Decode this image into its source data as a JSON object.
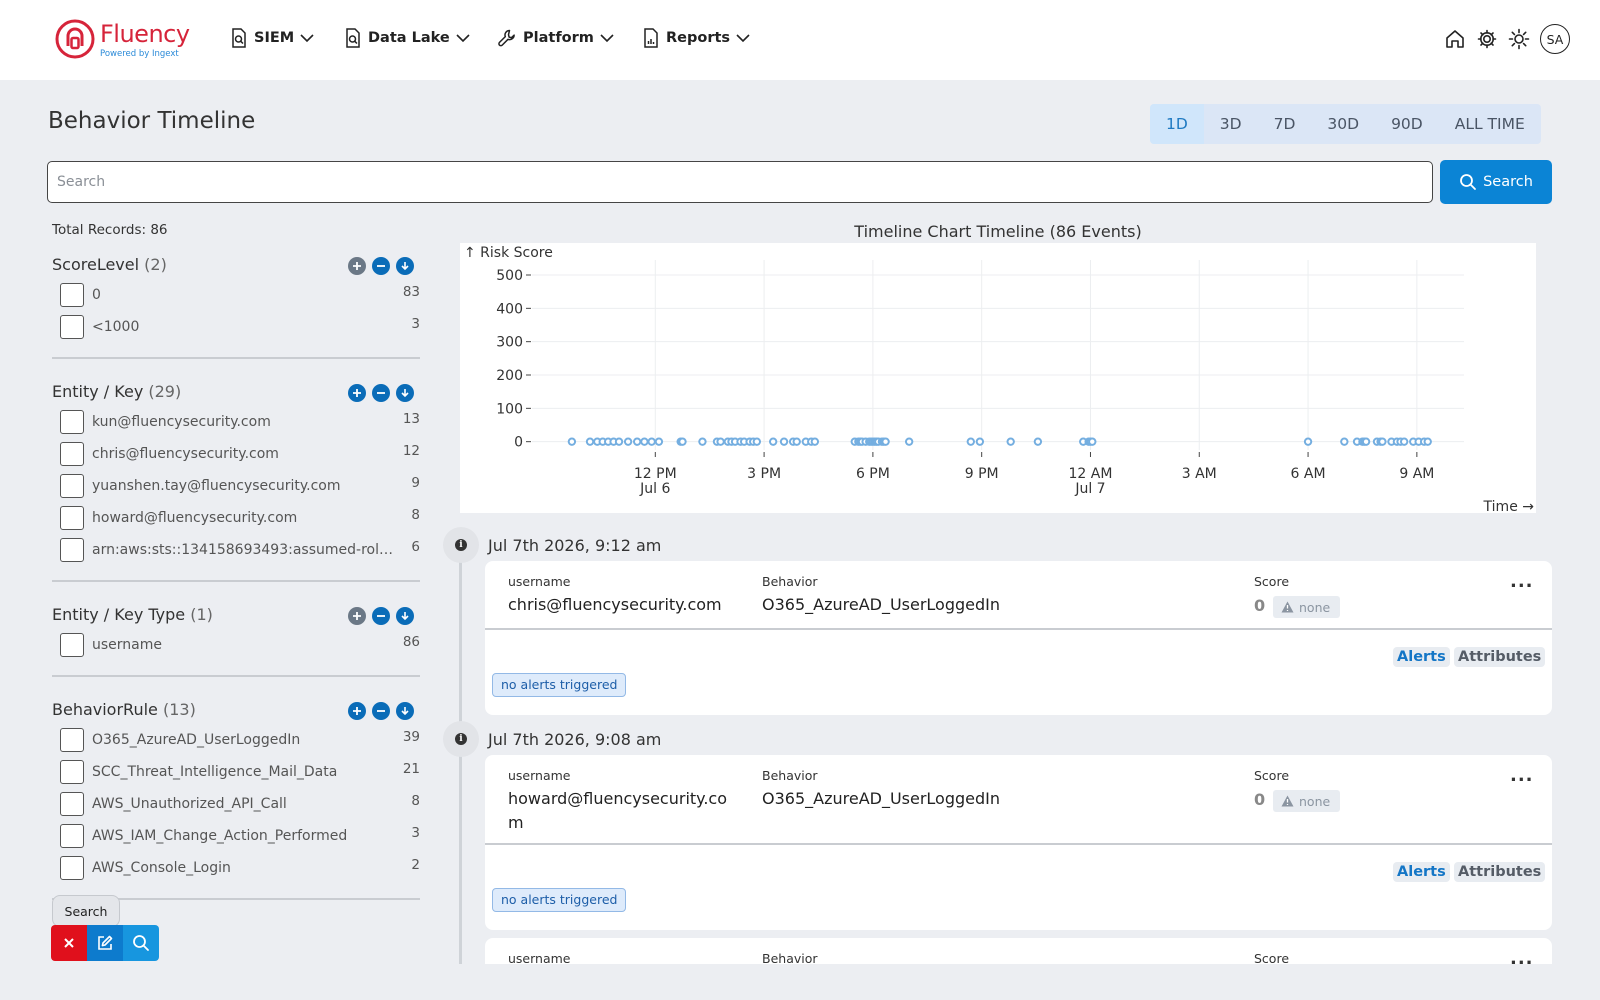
{
  "brand": {
    "name": "Fluency",
    "tagline": "Powered by Ingext",
    "color": "#d6243a"
  },
  "nav": [
    {
      "label": "SIEM",
      "icon": "search-doc-icon"
    },
    {
      "label": "Data Lake",
      "icon": "search-doc-icon"
    },
    {
      "label": "Platform",
      "icon": "wrench-icon"
    },
    {
      "label": "Reports",
      "icon": "report-icon"
    }
  ],
  "user": {
    "initials": "SA"
  },
  "page": {
    "title": "Behavior Timeline"
  },
  "time_ranges": [
    {
      "label": "1D",
      "active": true
    },
    {
      "label": "3D",
      "active": false
    },
    {
      "label": "7D",
      "active": false
    },
    {
      "label": "30D",
      "active": false
    },
    {
      "label": "90D",
      "active": false
    },
    {
      "label": "ALL TIME",
      "active": false
    }
  ],
  "search": {
    "placeholder": "Search",
    "value": "",
    "button_label": "Search"
  },
  "total_records": "Total Records: 86",
  "facets": [
    {
      "title": "ScoreLevel",
      "count": "(2)",
      "items": [
        {
          "label": "0",
          "count": "83"
        },
        {
          "label": "<1000",
          "count": "3"
        }
      ]
    },
    {
      "title": "Entity / Key",
      "count": "(29)",
      "items": [
        {
          "label": "kun@fluencysecurity.com",
          "count": "13"
        },
        {
          "label": "chris@fluencysecurity.com",
          "count": "12"
        },
        {
          "label": "yuanshen.tay@fluencysecurity.com",
          "count": "9"
        },
        {
          "label": "howard@fluencysecurity.com",
          "count": "8"
        },
        {
          "label": "arn:aws:sts::134158693493:assumed-role...",
          "count": "6"
        }
      ]
    },
    {
      "title": "Entity / Key Type",
      "count": "(1)",
      "items": [
        {
          "label": "username",
          "count": "86"
        }
      ]
    },
    {
      "title": "BehaviorRule",
      "count": "(13)",
      "items": [
        {
          "label": "O365_AzureAD_UserLoggedIn",
          "count": "39"
        },
        {
          "label": "SCC_Threat_Intelligence_Mail_Data",
          "count": "21"
        },
        {
          "label": "AWS_Unauthorized_API_Call",
          "count": "8"
        },
        {
          "label": "AWS_IAM_Change_Action_Performed",
          "count": "3"
        },
        {
          "label": "AWS_Console_Login",
          "count": "2"
        }
      ]
    }
  ],
  "toolbar": {
    "tooltip": "Search"
  },
  "chart_data": {
    "type": "scatter",
    "title": "Timeline Chart Timeline (86 Events)",
    "ylabel": "↑ Risk Score",
    "xlabel": "Time →",
    "ylim": [
      0,
      550
    ],
    "y_ticks": [
      "0",
      "100",
      "200",
      "300",
      "400",
      "500"
    ],
    "x_ticks": [
      {
        "h": 12,
        "label": "12 PM",
        "sub": "Jul 6"
      },
      {
        "h": 15,
        "label": "3 PM",
        "sub": ""
      },
      {
        "h": 18,
        "label": "6 PM",
        "sub": ""
      },
      {
        "h": 21,
        "label": "9 PM",
        "sub": ""
      },
      {
        "h": 24,
        "label": "12 AM",
        "sub": "Jul 7"
      },
      {
        "h": 27,
        "label": "3 AM",
        "sub": ""
      },
      {
        "h": 30,
        "label": "6 AM",
        "sub": ""
      },
      {
        "h": 33,
        "label": "9 AM",
        "sub": ""
      }
    ],
    "x_unit": "hours since Jul 6 00:00",
    "grid": true,
    "color": "#74aee0",
    "points_x": [
      9.7,
      10.2,
      10.4,
      10.55,
      10.7,
      10.85,
      11.0,
      11.25,
      11.5,
      11.7,
      11.9,
      12.1,
      12.7,
      12.75,
      13.3,
      13.7,
      13.8,
      14.0,
      14.1,
      14.2,
      14.35,
      14.45,
      14.6,
      14.7,
      14.8,
      15.25,
      15.55,
      15.8,
      15.9,
      16.15,
      16.3,
      16.4,
      17.5,
      17.6,
      17.65,
      17.7,
      17.8,
      17.9,
      17.95,
      18.0,
      18.05,
      18.1,
      18.15,
      18.25,
      18.3,
      18.35,
      19.0,
      20.7,
      20.95,
      21.8,
      22.55,
      23.8,
      23.95,
      24.0,
      24.05,
      30.0,
      31.0,
      31.35,
      31.5,
      31.55,
      31.6,
      31.9,
      32.0,
      32.05,
      32.3,
      32.45,
      32.55,
      32.65,
      32.9,
      33.05,
      33.2,
      33.3
    ],
    "points_y": [
      0,
      0,
      0,
      0,
      0,
      0,
      0,
      0,
      0,
      0,
      0,
      0,
      0,
      0,
      0,
      0,
      0,
      0,
      0,
      0,
      0,
      0,
      0,
      0,
      0,
      0,
      0,
      0,
      0,
      0,
      0,
      0,
      0,
      0,
      0,
      0,
      0,
      0,
      0,
      0,
      0,
      0,
      0,
      0,
      0,
      0,
      0,
      0,
      0,
      0,
      0,
      0,
      0,
      0,
      0,
      0,
      0,
      0,
      0,
      0,
      0,
      0,
      0,
      0,
      0,
      0,
      0,
      0,
      0,
      0,
      0,
      0
    ]
  },
  "events": [
    {
      "date": "Jul 7th 2026, 9:12 am",
      "entity_label": "username",
      "entity_value": "chris@fluencysecurity.com",
      "behavior_label": "Behavior",
      "behavior_value": "O365_AzureAD_UserLoggedIn",
      "score_label": "Score",
      "score_value": "0",
      "score_level": "none",
      "more": "...",
      "tab_alerts": "Alerts",
      "tab_attributes": "Attributes",
      "alerts_status": "no alerts triggered"
    },
    {
      "date": "Jul 7th 2026, 9:08 am",
      "entity_label": "username",
      "entity_value": "howard@fluencysecurity.co\nm",
      "behavior_label": "Behavior",
      "behavior_value": "O365_AzureAD_UserLoggedIn",
      "score_label": "Score",
      "score_value": "0",
      "score_level": "none",
      "more": "...",
      "tab_alerts": "Alerts",
      "tab_attributes": "Attributes",
      "alerts_status": "no alerts triggered"
    },
    {
      "entity_label": "username",
      "behavior_label": "Behavior",
      "score_label": "Score",
      "more": "..."
    }
  ]
}
